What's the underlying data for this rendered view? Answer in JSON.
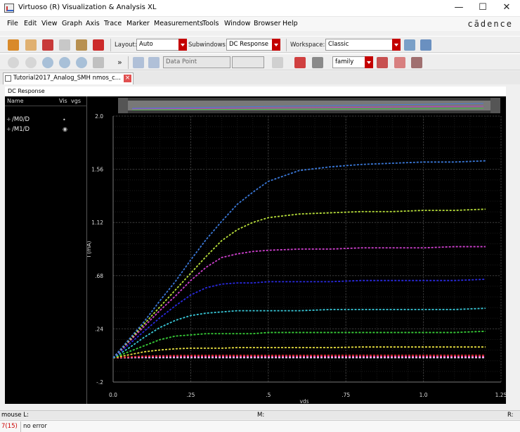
{
  "window": {
    "title": "Virtuoso (R) Visualization & Analysis XL",
    "minimize": "—",
    "maximize": "☐",
    "close": "✕"
  },
  "menubar": {
    "items": [
      "File",
      "Edit",
      "View",
      "Graph",
      "Axis",
      "Trace",
      "Marker",
      "Measurements",
      "Tools",
      "Window",
      "Browser",
      "Help"
    ],
    "brand": "cādence"
  },
  "toolbar1": {
    "layout_label": "Layout:",
    "layout_value": "Auto",
    "subwindows_label": "Subwindows:",
    "subwindows_value": "DC Response",
    "workspace_label": "Workspace:",
    "workspace_value": "Classic"
  },
  "toolbar2": {
    "more": "»",
    "data_point_value": "Data Point",
    "family_value": "family"
  },
  "tab": {
    "label": "Tutorial2017_Analog_SMH nmos_c..."
  },
  "panel": {
    "title": "DC Response"
  },
  "legend": {
    "col_name": "Name",
    "col_vis": "Vis",
    "col_vgs": "vgs",
    "signals": [
      {
        "name": "/M0/D",
        "vis": "•"
      },
      {
        "name": "/M1/D",
        "vis": "◉"
      }
    ]
  },
  "chart_data": {
    "type": "line",
    "title": "",
    "xlabel": "vds",
    "ylabel": "I (mA)",
    "xlim": [
      0.0,
      1.25
    ],
    "ylim": [
      -0.2,
      2.0
    ],
    "xticks": [
      "0.0",
      ".25",
      ".5",
      ".75",
      "1.0",
      "1.25"
    ],
    "yticks": [
      "2.0",
      "1.56",
      "1.12",
      ".68",
      ".24",
      "-.2"
    ],
    "ytick_values": [
      2.0,
      1.56,
      1.12,
      0.68,
      0.24,
      -0.2
    ],
    "xtick_values": [
      0.0,
      0.25,
      0.5,
      0.75,
      1.0,
      1.25
    ],
    "grid": true,
    "x": [
      0.0,
      0.05,
      0.1,
      0.15,
      0.2,
      0.25,
      0.3,
      0.35,
      0.4,
      0.45,
      0.5,
      0.6,
      0.7,
      0.8,
      0.9,
      1.0,
      1.1,
      1.2
    ],
    "series": [
      {
        "color": "#3a78d8",
        "values": [
          0.0,
          0.15,
          0.3,
          0.47,
          0.63,
          0.81,
          0.98,
          1.13,
          1.27,
          1.37,
          1.46,
          1.55,
          1.58,
          1.6,
          1.61,
          1.62,
          1.62,
          1.63
        ]
      },
      {
        "color": "#b8e03a",
        "values": [
          0.0,
          0.14,
          0.28,
          0.42,
          0.56,
          0.7,
          0.84,
          0.97,
          1.06,
          1.12,
          1.16,
          1.19,
          1.2,
          1.21,
          1.21,
          1.22,
          1.22,
          1.23
        ]
      },
      {
        "color": "#d040d0",
        "values": [
          0.0,
          0.13,
          0.26,
          0.39,
          0.51,
          0.64,
          0.75,
          0.83,
          0.86,
          0.88,
          0.89,
          0.9,
          0.9,
          0.91,
          0.91,
          0.91,
          0.92,
          0.92
        ]
      },
      {
        "color": "#2a2ae0",
        "values": [
          0.0,
          0.11,
          0.22,
          0.33,
          0.43,
          0.52,
          0.58,
          0.61,
          0.62,
          0.62,
          0.63,
          0.63,
          0.63,
          0.64,
          0.64,
          0.64,
          0.64,
          0.65
        ]
      },
      {
        "color": "#38c8d8",
        "values": [
          0.0,
          0.08,
          0.17,
          0.25,
          0.31,
          0.35,
          0.37,
          0.38,
          0.39,
          0.39,
          0.39,
          0.39,
          0.4,
          0.4,
          0.4,
          0.4,
          0.4,
          0.41
        ]
      },
      {
        "color": "#38d038",
        "values": [
          0.0,
          0.05,
          0.1,
          0.15,
          0.18,
          0.19,
          0.2,
          0.2,
          0.2,
          0.2,
          0.21,
          0.21,
          0.21,
          0.21,
          0.21,
          0.21,
          0.21,
          0.22
        ]
      },
      {
        "color": "#e8e040",
        "values": [
          0.0,
          0.025,
          0.05,
          0.065,
          0.075,
          0.08,
          0.08,
          0.08,
          0.085,
          0.085,
          0.085,
          0.085,
          0.085,
          0.09,
          0.09,
          0.09,
          0.09,
          0.09
        ]
      },
      {
        "color": "#e03030",
        "values": [
          0.0,
          0.008,
          0.014,
          0.017,
          0.019,
          0.02,
          0.02,
          0.02,
          0.02,
          0.02,
          0.02,
          0.02,
          0.021,
          0.021,
          0.021,
          0.021,
          0.021,
          0.021
        ]
      },
      {
        "color": "#ff60c0",
        "values": [
          0.0,
          0.004,
          0.007,
          0.009,
          0.01,
          0.01,
          0.01,
          0.01,
          0.01,
          0.01,
          0.01,
          0.01,
          0.01,
          0.01,
          0.01,
          0.01,
          0.01,
          0.01
        ]
      },
      {
        "color": "#e0e0ff",
        "values": [
          0.0,
          0.001,
          0.002,
          0.002,
          0.002,
          0.002,
          0.002,
          0.002,
          0.002,
          0.002,
          0.002,
          0.002,
          0.002,
          0.002,
          0.002,
          0.002,
          0.002,
          0.002
        ]
      }
    ]
  },
  "statusbar": {
    "mouse": "mouse L:",
    "middle": "M:",
    "right": "R:"
  },
  "cmdbar": {
    "count": "7(15)",
    "message": "no error"
  }
}
